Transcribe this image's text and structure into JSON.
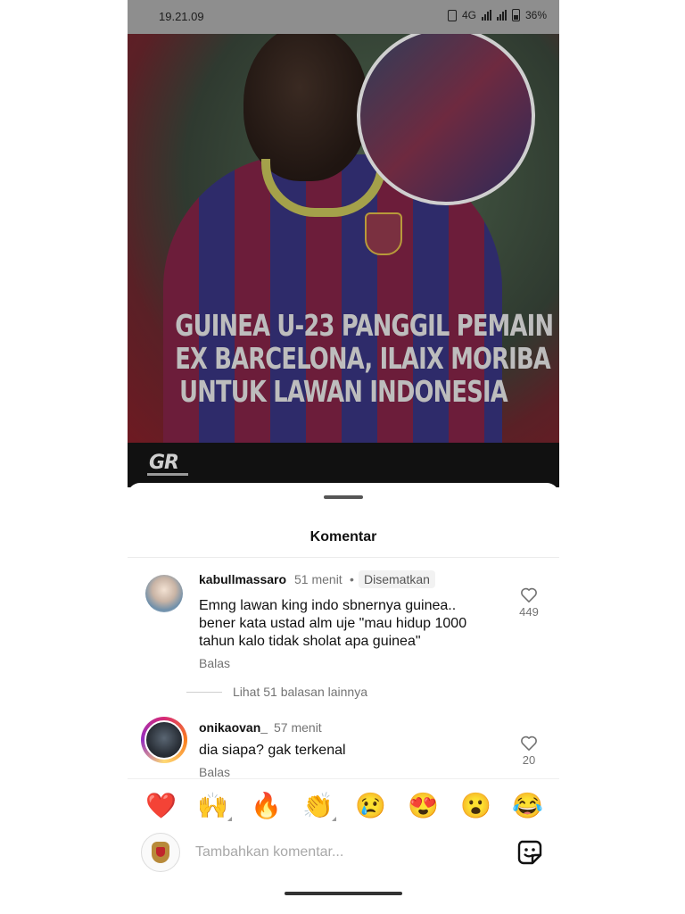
{
  "status_bar": {
    "time": "19.21.09",
    "network": "4G",
    "battery": "36%"
  },
  "post": {
    "headline_lines": [
      "GUINEA U-23 PANGGIL PEMAIN",
      "EX BARCELONA, ILAIX MORIBA",
      "UNTUK LAWAN INDONESIA"
    ],
    "watermark": "GR"
  },
  "sheet": {
    "title": "Komentar"
  },
  "comments": [
    {
      "username": "kabullmassaro",
      "time": "51 menit",
      "separator": "•",
      "pinned_label": "Disematkan",
      "text_lines": [
        "Emng lawan king indo sbnernya guinea..",
        "bener kata ustad alm uje \"mau hidup 1000",
        "tahun kalo tidak sholat apa guinea\""
      ],
      "reply_label": "Balas",
      "likes": "449"
    },
    {
      "username": "onikaovan_",
      "time": "57 menit",
      "text": "dia siapa? gak terkenal",
      "reply_label": "Balas",
      "likes": "20"
    }
  ],
  "more_replies": "Lihat 51 balasan lainnya",
  "reactions": [
    "❤️",
    "🙌",
    "🔥",
    "👏",
    "😢",
    "😍",
    "😮",
    "😂"
  ],
  "composer": {
    "placeholder": "Tambahkan komentar..."
  }
}
